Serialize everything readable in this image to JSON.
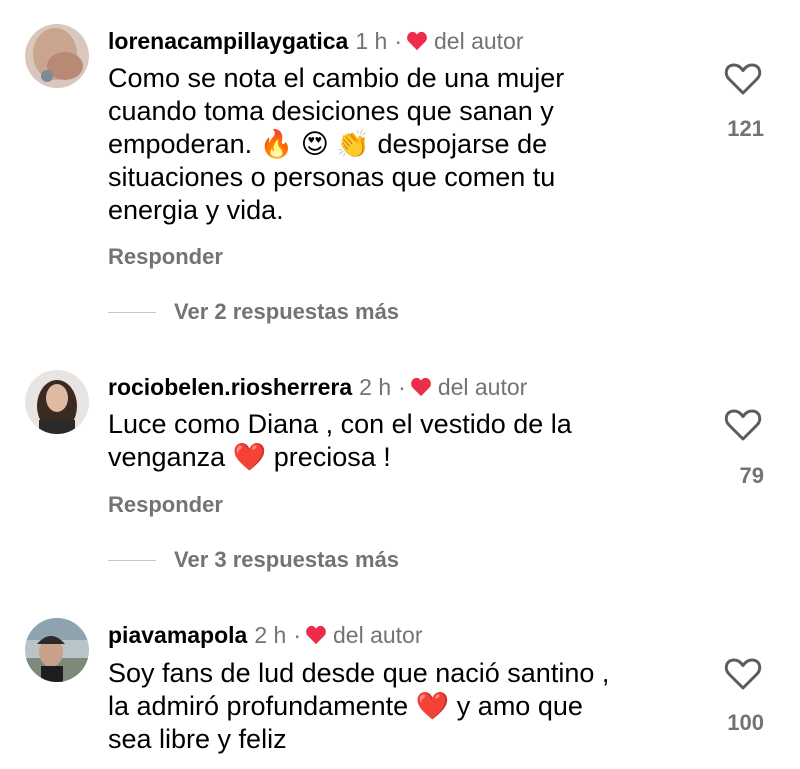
{
  "comments": [
    {
      "username": "lorenacampillaygatica",
      "time": "1 h",
      "author_label": "del autor",
      "text_lines": [
        "Como se nota el cambio de una mujer",
        "cuando toma desiciones que sanan y",
        "empoderan. 🔥 😍 👏 despojarse de",
        "situaciones o personas que comen tu",
        "energia y vida."
      ],
      "reply_label": "Responder",
      "likes": "121",
      "more_replies": "Ver 2 respuestas más"
    },
    {
      "username": "rociobelen.riosherrera",
      "time": "2 h",
      "author_label": "del autor",
      "text_lines": [
        "Luce como Diana , con el vestido de la",
        "venganza ❤️  preciosa !"
      ],
      "reply_label": "Responder",
      "likes": "79",
      "more_replies": "Ver 3 respuestas más"
    },
    {
      "username": "piavamapola",
      "time": "2 h",
      "author_label": "del autor",
      "text_lines": [
        "Soy fans de lud desde que nació santino ,",
        "la admiró profundamente ❤️  y amo que",
        "sea libre y feliz"
      ],
      "likes": "100"
    }
  ],
  "colors": {
    "heart_red": "#ed2c4a",
    "muted": "#737373"
  },
  "icons": {
    "author_like": "red-heart-icon",
    "like": "heart-outline-icon"
  }
}
